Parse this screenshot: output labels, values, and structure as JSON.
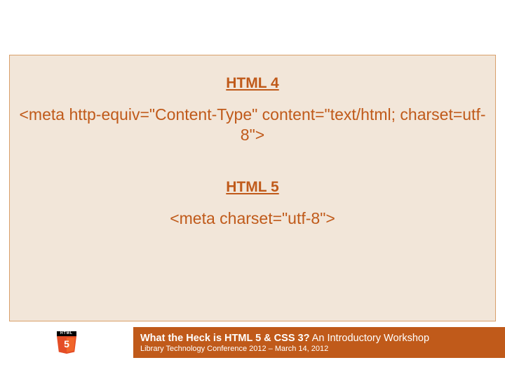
{
  "sections": {
    "html4": {
      "heading": "HTML 4",
      "code": "<meta http-equiv=\"Content-Type\" content=\"text/html; charset=utf-8\">"
    },
    "html5": {
      "heading": "HTML 5",
      "code": "<meta charset=\"utf-8\">"
    }
  },
  "badge": {
    "top": "HTML",
    "num": "5"
  },
  "footer": {
    "title_bold": "What the Heck is HTML 5 & CSS 3?",
    "title_rest": "  An Introductory Workshop",
    "subtitle": "Library Technology Conference 2012 – March 14, 2012"
  }
}
